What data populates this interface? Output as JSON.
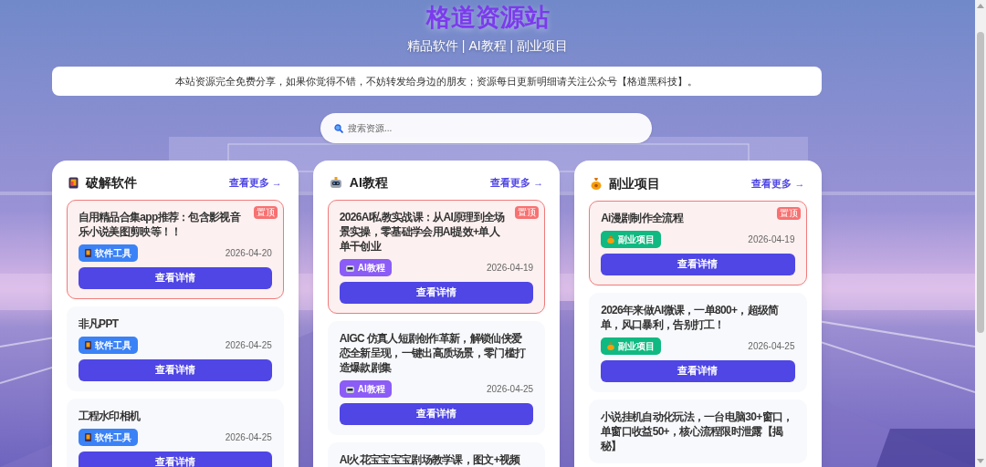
{
  "header": {
    "title": "格道资源站",
    "subtitle": "精品软件 | AI教程 | 副业项目"
  },
  "notice": "本站资源完全免费分享，如果你觉得不错，不妨转发给身边的朋友；资源每日更新明细请关注公众号【格道黑科技】。",
  "search": {
    "placeholder": "搜索资源..."
  },
  "sections": [
    {
      "title": "破解软件",
      "more_link": "查看更多 →",
      "color": "#3b82f6",
      "items": [
        {
          "title": "自用精品合集app推荐：包含影视音乐小说美图剪映等！！",
          "pinned": true,
          "badge": "置顶",
          "tag": "软件工具",
          "date": "2026-04-20",
          "button": "查看详情"
        },
        {
          "title": "非凡PPT",
          "pinned": false,
          "tag": "软件工具",
          "date": "2026-04-25",
          "button": "查看详情"
        },
        {
          "title": "工程水印相机",
          "pinned": false,
          "tag": "软件工具",
          "date": "2026-04-25",
          "button": "查看详情"
        }
      ]
    },
    {
      "title": "AI教程",
      "more_link": "查看更多 →",
      "color": "#8b5cf6",
      "items": [
        {
          "title": "2026AI私教实战课：从AI原理到全场景实操，零基础学会用AI提效+单人单干创业",
          "pinned": true,
          "badge": "置顶",
          "tag": "AI教程",
          "date": "2026-04-19",
          "button": "查看详情"
        },
        {
          "title": "AIGC 仿真人短剧创作革新，解锁仙侠爱恋全新呈现，一键出高质场景，零门槛打造爆款剧集",
          "pinned": false,
          "tag": "AI教程",
          "date": "2026-04-25",
          "button": "查看详情"
        },
        {
          "title": "AI火花宝宝宝宝剧场教学课，图文+视频",
          "pinned": false
        }
      ]
    },
    {
      "title": "副业项目",
      "more_link": "查看更多 →",
      "color": "#10b981",
      "items": [
        {
          "title": "Ai漫剧制作全流程",
          "pinned": true,
          "badge": "置顶",
          "tag": "副业项目",
          "date": "2026-04-19",
          "button": "查看详情"
        },
        {
          "title": "2026年来做AI微课，一单800+，超级简单，风口暴利，告别打工！",
          "pinned": false,
          "tag": "副业项目",
          "date": "2026-04-25",
          "button": "查看详情"
        },
        {
          "title": "小说挂机自动化玩法，一台电脑30+窗口，单窗口收益50+，核心流程限时泄露【揭秘】",
          "pinned": false
        }
      ]
    }
  ]
}
